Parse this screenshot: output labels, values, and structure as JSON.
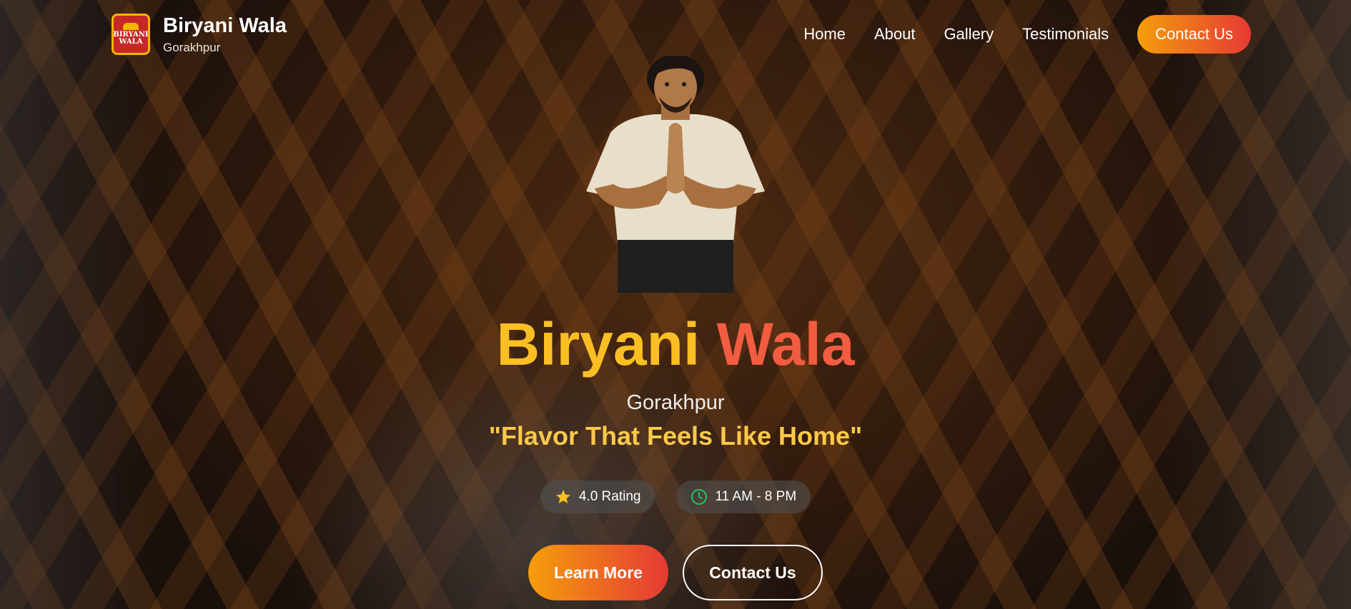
{
  "brand": {
    "name": "Biryani Wala",
    "city": "Gorakhpur",
    "logo_text_line1": "BIRYANI",
    "logo_text_line2": "WALA"
  },
  "nav": {
    "items": [
      "Home",
      "About",
      "Gallery",
      "Testimonials"
    ],
    "contact_label": "Contact Us"
  },
  "hero": {
    "title_word1": "Biryani",
    "title_word2": "Wala",
    "city": "Gorakhpur",
    "tagline": "\"Flavor That Feels Like Home\"",
    "rating_label": "4.0 Rating",
    "hours_label": "11 AM - 8 PM",
    "learn_more_label": "Learn More",
    "contact_label": "Contact Us"
  },
  "colors": {
    "accent_start": "#f59e0b",
    "accent_end": "#e53935",
    "title_gold": "#fbbf24",
    "title_orange": "#f25c40",
    "tagline": "#fbc94a",
    "clock_icon": "#22c55e",
    "star_icon": "#fbbf24"
  },
  "icons": {
    "rating": "star-icon",
    "hours": "clock-icon"
  }
}
